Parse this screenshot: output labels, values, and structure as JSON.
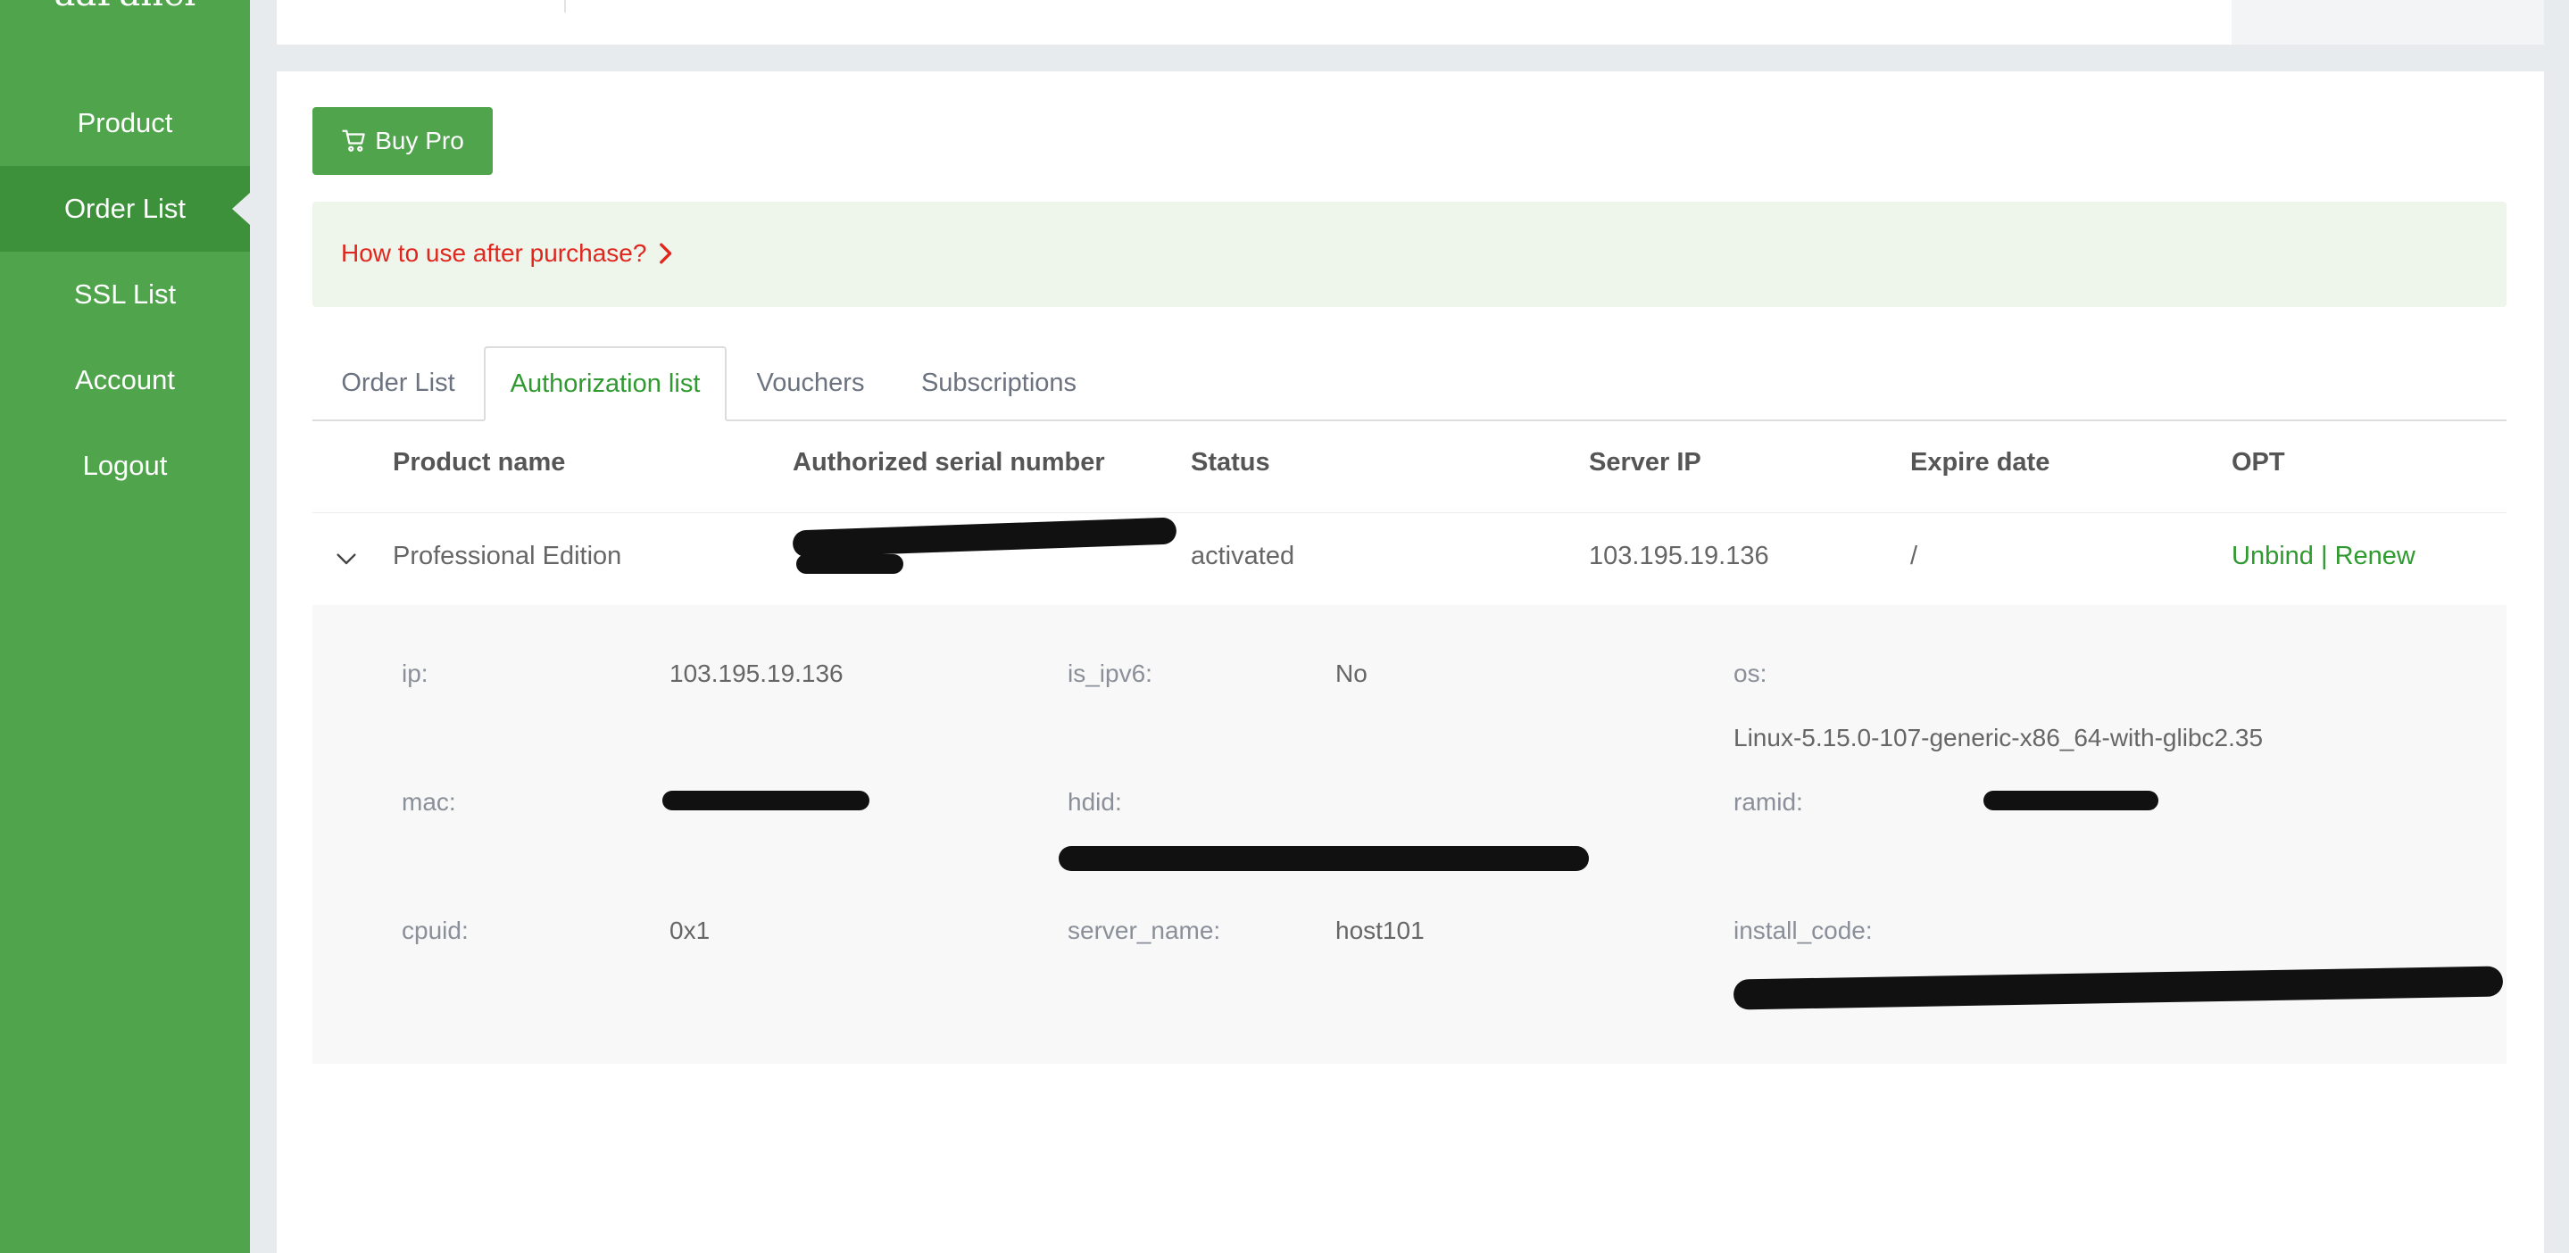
{
  "app": {
    "logo_text": "aaPanel"
  },
  "sidebar": {
    "items": [
      {
        "label": "Product"
      },
      {
        "label": "Order List",
        "active": true
      },
      {
        "label": "SSL List"
      },
      {
        "label": "Account"
      },
      {
        "label": "Logout"
      }
    ]
  },
  "actions": {
    "buy_pro_label": "Buy Pro"
  },
  "howto": {
    "label": "How to use after purchase?"
  },
  "tabs": [
    {
      "label": "Order List"
    },
    {
      "label": "Authorization list",
      "active": true
    },
    {
      "label": "Vouchers"
    },
    {
      "label": "Subscriptions"
    }
  ],
  "table": {
    "headers": [
      "Product name",
      "Authorized serial number",
      "Status",
      "Server IP",
      "Expire date",
      "OPT"
    ],
    "rows": [
      {
        "product_name": "Professional Edition",
        "serial_number": "[redacted]",
        "status": "activated",
        "server_ip": "103.195.19.136",
        "expire_date": "/",
        "opt_unbind": "Unbind",
        "opt_sep": "|",
        "opt_renew": "Renew"
      }
    ]
  },
  "details": {
    "ip_label": "ip:",
    "ip_value": "103.195.19.136",
    "is_ipv6_label": "is_ipv6:",
    "is_ipv6_value": "No",
    "os_label": "os:",
    "os_value": "Linux-5.15.0-107-generic-x86_64-with-glibc2.35",
    "mac_label": "mac:",
    "hdid_label": "hdid:",
    "ramid_label": "ramid:",
    "cpuid_label": "cpuid:",
    "cpuid_value": "0x1",
    "server_name_label": "server_name:",
    "server_name_value": "host101",
    "install_code_label": "install_code:"
  },
  "colors": {
    "brand_green": "#4fa44c",
    "active_nav": "#3c913a",
    "link_red": "#e0271f",
    "tab_active_green": "#2f9a2f"
  }
}
